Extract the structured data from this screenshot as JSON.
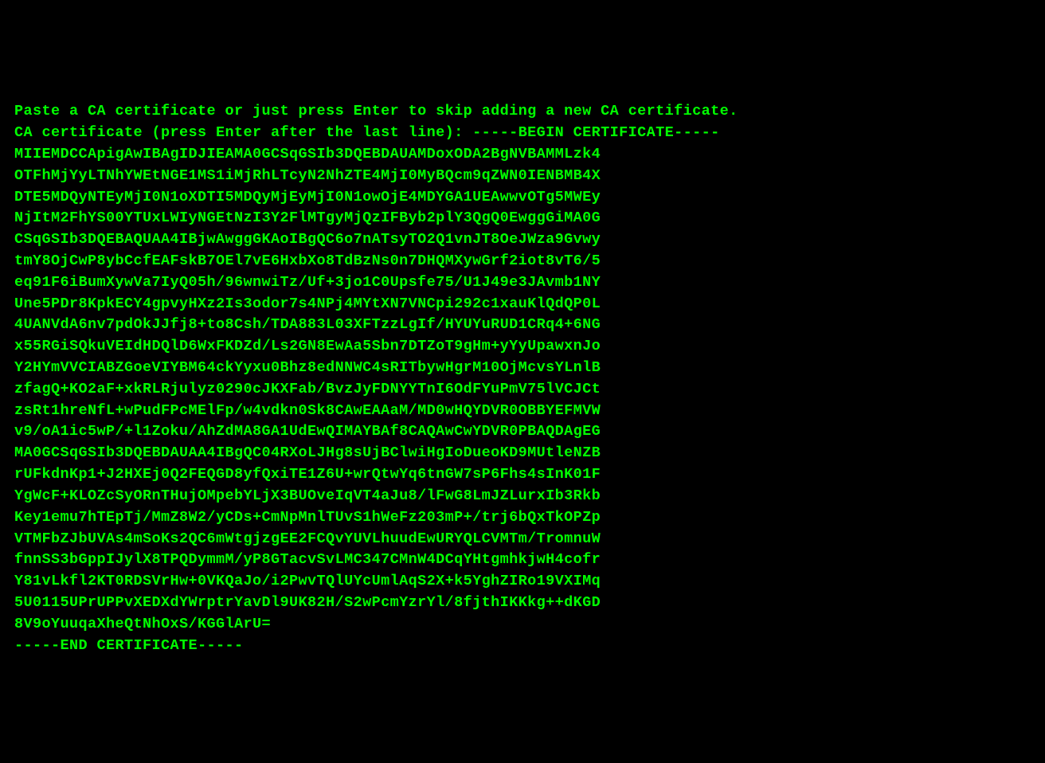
{
  "terminal": {
    "lines": [
      "Paste a CA certificate or just press Enter to skip adding a new CA certificate.",
      "CA certificate (press Enter after the last line): -----BEGIN CERTIFICATE-----",
      "MIIEMDCCApigAwIBAgIDJIEAMA0GCSqGSIb3DQEBDAUAMDoxODA2BgNVBAMMLzk4",
      "OTFhMjYyLTNhYWEtNGE1MS1iMjRhLTcyN2NhZTE4MjI0MyBQcm9qZWN0IENBMB4X",
      "DTE5MDQyNTEyMjI0N1oXDTI5MDQyMjEyMjI0N1owOjE4MDYGA1UEAwwvOTg5MWEy",
      "NjItM2FhYS00YTUxLWIyNGEtNzI3Y2FlMTgyMjQzIFByb2plY3QgQ0EwggGiMA0G",
      "CSqGSIb3DQEBAQUAA4IBjwAwggGKAoIBgQC6o7nATsyTO2Q1vnJT8OeJWza9Gvwy",
      "tmY8OjCwP8ybCcfEAFskB7OEl7vE6HxbXo8TdBzNs0n7DHQMXywGrf2iot8vT6/5",
      "eq91F6iBumXywVa7IyQ05h/96wnwiTz/Uf+3jo1C0Upsfe75/U1J49e3JAvmb1NY",
      "Une5PDr8KpkECY4gpvyHXz2Is3odor7s4NPj4MYtXN7VNCpi292c1xauKlQdQP0L",
      "4UANVdA6nv7pdOkJJfj8+to8Csh/TDA883L03XFTzzLgIf/HYUYuRUD1CRq4+6NG",
      "x55RGiSQkuVEIdHDQlD6WxFKDZd/Ls2GN8EwAa5Sbn7DTZoT9gHm+yYyUpawxnJo",
      "Y2HYmVVCIABZGoeVIYBM64ckYyxu0Bhz8edNNWC4sRITbywHgrM10OjMcvsYLnlB",
      "zfagQ+KO2aF+xkRLRjulyz0290cJKXFab/BvzJyFDNYYTnI6OdFYuPmV75lVCJCt",
      "zsRt1hreNfL+wPudFPcMElFp/w4vdkn0Sk8CAwEAAaM/MD0wHQYDVR0OBBYEFMVW",
      "v9/oA1ic5wP/+l1Zoku/AhZdMA8GA1UdEwQIMAYBAf8CAQAwCwYDVR0PBAQDAgEG",
      "MA0GCSqGSIb3DQEBDAUAA4IBgQC04RXoLJHg8sUjBClwiHgIoDueoKD9MUtleNZB",
      "rUFkdnKp1+J2HXEj0Q2FEQGD8yfQxiTE1Z6U+wrQtwYq6tnGW7sP6Fhs4sInK01F",
      "YgWcF+KLOZcSyORnTHujOMpebYLjX3BUOveIqVT4aJu8/lFwG8LmJZLurxIb3Rkb",
      "Key1emu7hTEpTj/MmZ8W2/yCDs+CmNpMnlTUvS1hWeFz203mP+/trj6bQxTkOPZp",
      "VTMFbZJbUVAs4mSoKs2QC6mWtgjzgEE2FCQvYUVLhuudEwURYQLCVMTm/TromnuW",
      "fnnSS3bGppIJylX8TPQDymmM/yP8GTacvSvLMC347CMnW4DCqYHtgmhkjwH4cofr",
      "Y81vLkfl2KT0RDSVrHw+0VKQaJo/i2PwvTQlUYcUmlAqS2X+k5YghZIRo19VXIMq",
      "5U0115UPrUPPvXEDXdYWrptrYavDl9UK82H/S2wPcmYzrYl/8fjthIKKkg++dKGD",
      "8V9oYuuqaXheQtNhOxS/KGGlArU=",
      "-----END CERTIFICATE-----"
    ]
  }
}
